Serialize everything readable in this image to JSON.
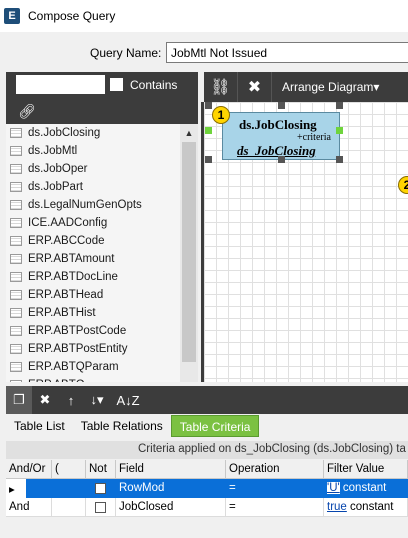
{
  "window": {
    "title": "Compose Query",
    "icon": "E"
  },
  "query_name": {
    "label": "Query Name:",
    "value": "JobMtl Not Issued"
  },
  "search": {
    "value": "",
    "contains_label": "Contains"
  },
  "tables": [
    "ds.JobClosing",
    "ds.JobMtl",
    "ds.JobOper",
    "ds.JobPart",
    "ds.LegalNumGenOpts",
    "ICE.AADConfig",
    "ERP.ABCCode",
    "ERP.ABTAmount",
    "ERP.ABTDocLine",
    "ERP.ABTHead",
    "ERP.ABTHist",
    "ERP.ABTPostCode",
    "ERP.ABTPostEntity",
    "ERP.ABTQParam",
    "ERP.ABTQ..."
  ],
  "diagram_toolbar": {
    "link_icon": "link-icon",
    "delete_icon": "close-icon",
    "arrange_label": "Arrange Diagram"
  },
  "diagram": {
    "node": {
      "title": "ds.JobClosing",
      "criteria": "+criteria",
      "alias": "ds_JobClosing",
      "badge": "1"
    },
    "node2": {
      "badge": "2"
    }
  },
  "bottom_toolbar": {
    "icons": [
      "copy-icon",
      "close-icon",
      "arrow-up-icon",
      "arrow-down-icon",
      "sort-icon"
    ],
    "sort_label": "A↓Z"
  },
  "tabs": [
    "Table List",
    "Table Relations",
    "Table Criteria"
  ],
  "criteria": {
    "header": "Criteria applied on ds_JobClosing (ds.JobClosing) ta",
    "columns": [
      "And/Or",
      "(",
      "Not",
      "Field",
      "Operation",
      "Filter Value"
    ],
    "rows": [
      {
        "andor": "",
        "paren": "",
        "field": "RowMod",
        "operation": "=",
        "value_link": "'U'",
        "value_type": "constant"
      },
      {
        "andor": "And",
        "paren": "",
        "field": "JobClosed",
        "operation": "=",
        "value_link": "true",
        "value_type": "constant"
      }
    ]
  },
  "colors": {
    "accent": "#7bc142",
    "selection": "#0a6fd8",
    "dark_toolbar": "#3c3c3c",
    "node_fill": "#a8d4e8"
  }
}
